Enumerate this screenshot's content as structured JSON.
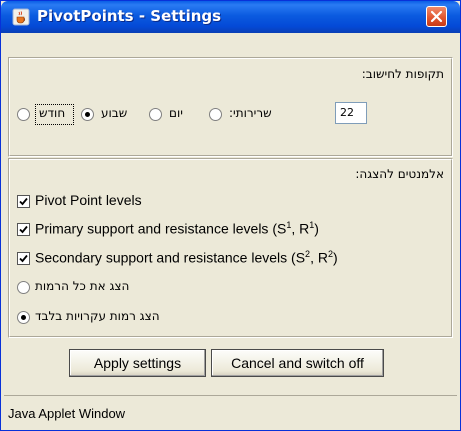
{
  "window": {
    "title": "PivotPoints - Settings",
    "icon": "java-cup-icon",
    "close_icon": "close-icon"
  },
  "periods": {
    "label": "תקופות לחישוב:",
    "options": [
      {
        "label": "חודש",
        "selected": false
      },
      {
        "label": "שבוע",
        "selected": true
      },
      {
        "label": "יום",
        "selected": false
      },
      {
        "label": "שרירותי:",
        "selected": false
      }
    ],
    "custom_value": "22"
  },
  "elements": {
    "label": "אלמנטים להצגה:",
    "checkboxes": {
      "pivot": {
        "label": "Pivot Point levels",
        "checked": true
      },
      "primary": {
        "label_main": "Primary support and resistance levels (S",
        "s_sup": "1",
        "mid": ", R",
        "r_sup": "1",
        "end": ")",
        "checked": true
      },
      "secondary": {
        "label_main": "Secondary support and resistance levels (S",
        "s_sup": "2",
        "mid": ", R",
        "r_sup": "2",
        "end": ")",
        "checked": true
      }
    },
    "show_options": [
      {
        "label": "הצג את כל הרמות",
        "selected": false
      },
      {
        "label": "הצג רמות עקרויות בלבד",
        "selected": true
      }
    ]
  },
  "buttons": {
    "apply": "Apply settings",
    "cancel": "Cancel and switch off"
  },
  "status": {
    "text": "Java Applet Window"
  }
}
